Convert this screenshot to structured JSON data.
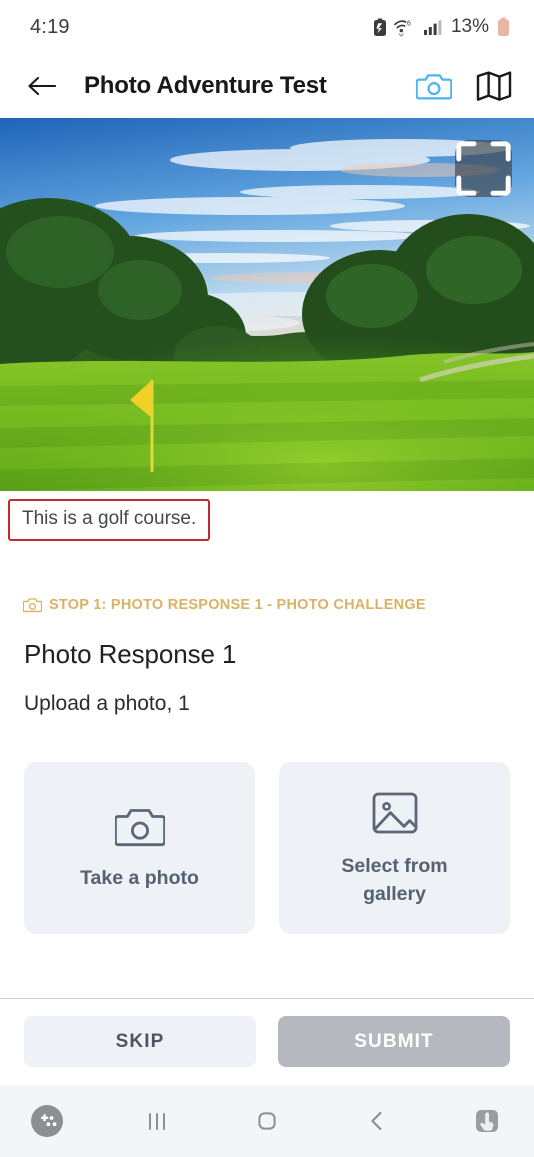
{
  "status_bar": {
    "time": "4:19",
    "battery_percent": "13%",
    "icons": [
      "nfc-battery-icon",
      "wifi-6-icon",
      "cellular-signal-icon",
      "battery-icon"
    ]
  },
  "app_bar": {
    "title": "Photo Adventure Test",
    "back_icon": "back-arrow-icon",
    "camera_icon": "camera-icon",
    "camera_color": "#4fb4ef",
    "map_icon": "map-icon"
  },
  "hero": {
    "alt": "golf course green with yellow flag",
    "expand_icon": "fullscreen-expand-icon"
  },
  "caption": {
    "text": "This is a golf course.",
    "border_color": "#c22a2e"
  },
  "stop": {
    "icon": "camera-icon",
    "label": "STOP 1: PHOTO RESPONSE 1 - PHOTO CHALLENGE",
    "color": "#d9b264"
  },
  "question": {
    "title": "Photo Response 1",
    "description": "Upload a photo, 1"
  },
  "photo_options": [
    {
      "icon": "camera-icon",
      "label": "Take a photo"
    },
    {
      "icon": "image-gallery-icon",
      "label": "Select from gallery"
    }
  ],
  "actions": {
    "skip_label": "SKIP",
    "submit_label": "SUBMIT",
    "submit_color": "#b5b8be"
  },
  "nav_bar": {
    "items": [
      {
        "icon": "game-booster-icon",
        "label": "Game Booster"
      },
      {
        "icon": "recents-icon",
        "label": "Recents"
      },
      {
        "icon": "home-icon",
        "label": "Home"
      },
      {
        "icon": "back-icon",
        "label": "Back"
      },
      {
        "icon": "touch-assist-icon",
        "label": "Touch assist"
      }
    ]
  }
}
